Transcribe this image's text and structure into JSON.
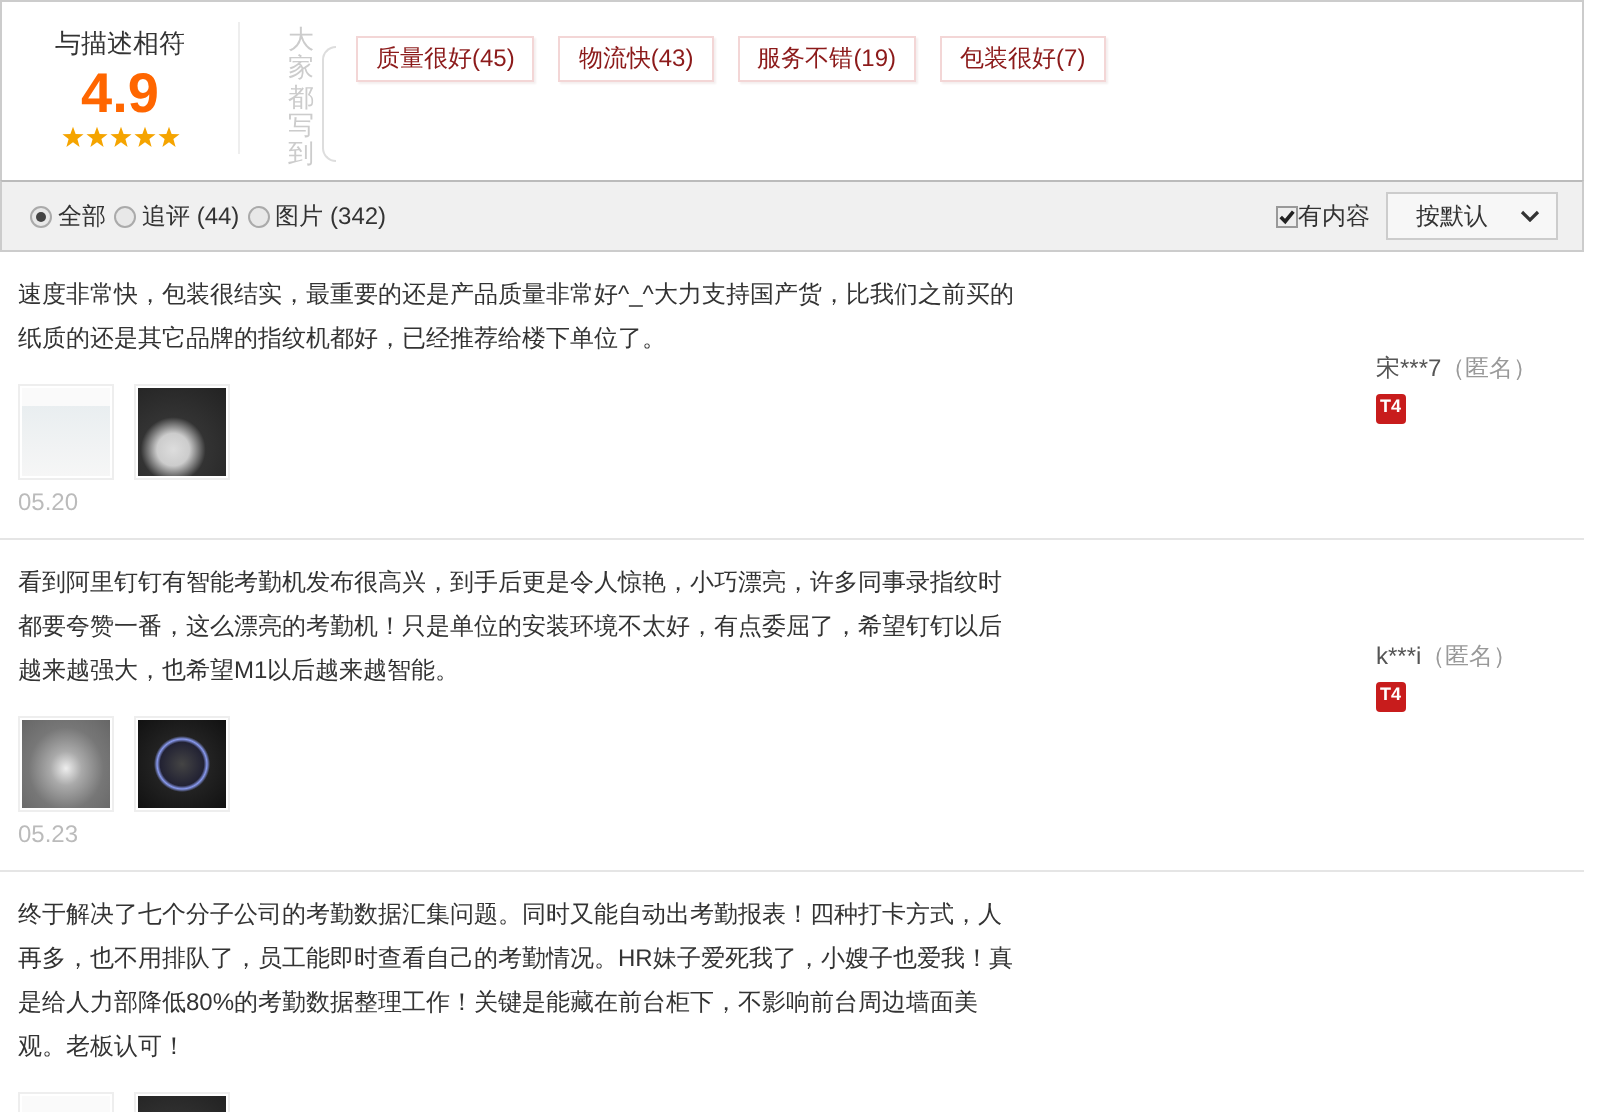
{
  "rating": {
    "label": "与描述相符",
    "score": "4.9",
    "stars": 5
  },
  "tags_heading": "大家都写到",
  "tags": [
    "质量很好(45)",
    "物流快(43)",
    "服务不错(19)",
    "包装很好(7)"
  ],
  "filters": [
    {
      "label": "全部",
      "selected": true
    },
    {
      "label": "追评 (44)",
      "selected": false
    },
    {
      "label": "图片 (342)",
      "selected": false
    }
  ],
  "content_only": {
    "label": "有内容",
    "checked": true
  },
  "sort": {
    "value": "按默认"
  },
  "reviews": [
    {
      "text": "速度非常快，包装很结实，最重要的还是产品质量非常好^_^大力支持国产货，比我们之前买的纸质的还是其它品牌的指纹机都好，已经推荐给楼下单位了。",
      "photos": [
        {
          "kind": "screenshot"
        },
        {
          "kind": "device"
        }
      ],
      "date": "05.20",
      "user": "宋***7",
      "anon": "（匿名）",
      "badge": "T4"
    },
    {
      "text": "看到阿里钉钉有智能考勤机发布很高兴，到手后更是令人惊艳，小巧漂亮，许多同事录指纹时都要夸赞一番，这么漂亮的考勤机！只是单位的安装环境不太好，有点委屈了，希望钉钉以后越来越强大，也希望M1以后越来越智能。",
      "photos": [
        {
          "kind": "grey"
        },
        {
          "kind": "dark"
        }
      ],
      "date": "05.23",
      "user": "k***i",
      "anon": "（匿名）",
      "badge": "T4"
    },
    {
      "text": "终于解决了七个分子公司的考勤数据汇集问题。同时又能自动出考勤报表！四种打卡方式，人再多，也不用排队了，员工能即时查看自己的考勤情况。HR妹子爱死我了，小嫂子也爱我！真是给人力部降低80%的考勤数据整理工作！关键是能藏在前台柜下，不影响前台周边墙面美观。老板认可！",
      "photos": [
        {
          "kind": "screenshot"
        },
        {
          "kind": "device"
        }
      ]
    }
  ]
}
